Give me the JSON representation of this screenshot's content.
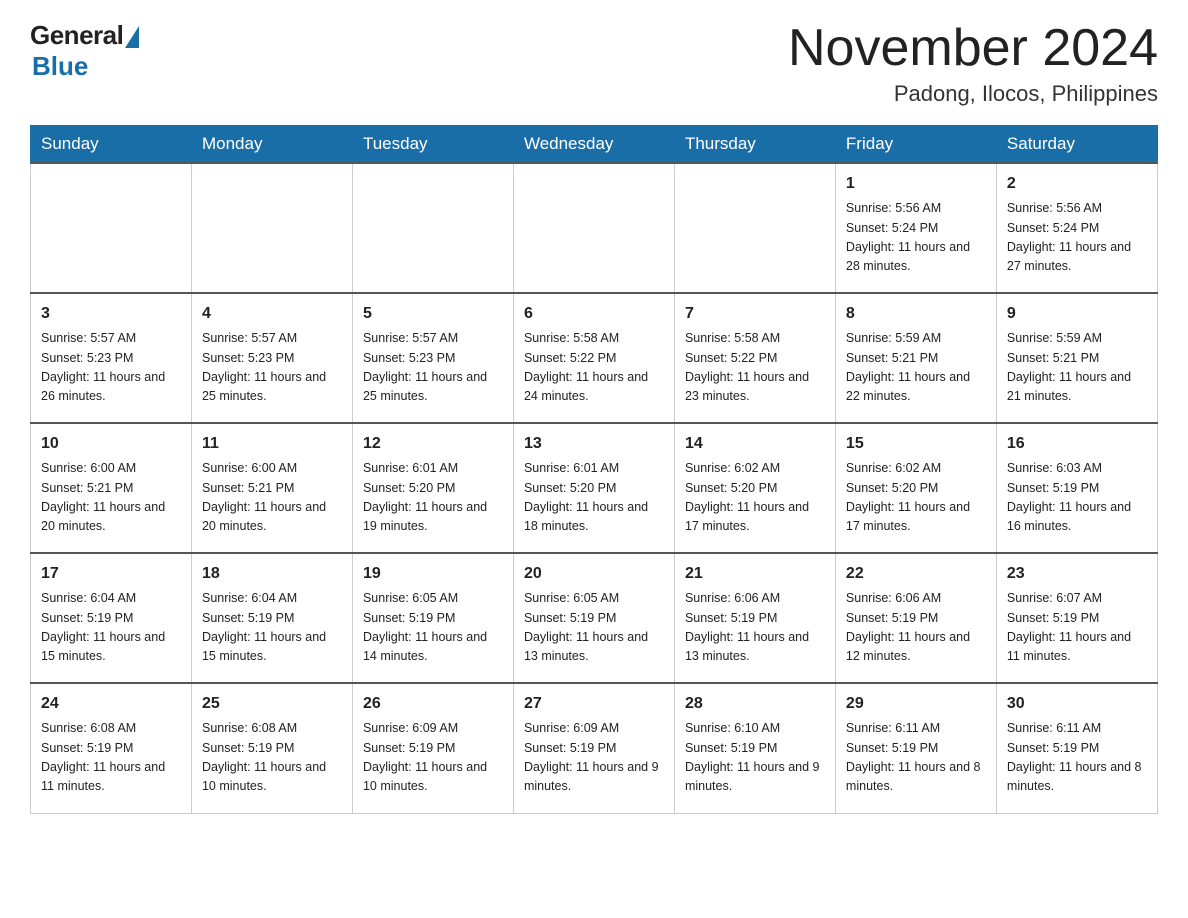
{
  "header": {
    "logo_general": "General",
    "logo_blue": "Blue",
    "month_title": "November 2024",
    "subtitle": "Padong, Ilocos, Philippines"
  },
  "calendar": {
    "days_of_week": [
      "Sunday",
      "Monday",
      "Tuesday",
      "Wednesday",
      "Thursday",
      "Friday",
      "Saturday"
    ],
    "weeks": [
      [
        {
          "day": "",
          "info": ""
        },
        {
          "day": "",
          "info": ""
        },
        {
          "day": "",
          "info": ""
        },
        {
          "day": "",
          "info": ""
        },
        {
          "day": "",
          "info": ""
        },
        {
          "day": "1",
          "info": "Sunrise: 5:56 AM\nSunset: 5:24 PM\nDaylight: 11 hours and 28 minutes."
        },
        {
          "day": "2",
          "info": "Sunrise: 5:56 AM\nSunset: 5:24 PM\nDaylight: 11 hours and 27 minutes."
        }
      ],
      [
        {
          "day": "3",
          "info": "Sunrise: 5:57 AM\nSunset: 5:23 PM\nDaylight: 11 hours and 26 minutes."
        },
        {
          "day": "4",
          "info": "Sunrise: 5:57 AM\nSunset: 5:23 PM\nDaylight: 11 hours and 25 minutes."
        },
        {
          "day": "5",
          "info": "Sunrise: 5:57 AM\nSunset: 5:23 PM\nDaylight: 11 hours and 25 minutes."
        },
        {
          "day": "6",
          "info": "Sunrise: 5:58 AM\nSunset: 5:22 PM\nDaylight: 11 hours and 24 minutes."
        },
        {
          "day": "7",
          "info": "Sunrise: 5:58 AM\nSunset: 5:22 PM\nDaylight: 11 hours and 23 minutes."
        },
        {
          "day": "8",
          "info": "Sunrise: 5:59 AM\nSunset: 5:21 PM\nDaylight: 11 hours and 22 minutes."
        },
        {
          "day": "9",
          "info": "Sunrise: 5:59 AM\nSunset: 5:21 PM\nDaylight: 11 hours and 21 minutes."
        }
      ],
      [
        {
          "day": "10",
          "info": "Sunrise: 6:00 AM\nSunset: 5:21 PM\nDaylight: 11 hours and 20 minutes."
        },
        {
          "day": "11",
          "info": "Sunrise: 6:00 AM\nSunset: 5:21 PM\nDaylight: 11 hours and 20 minutes."
        },
        {
          "day": "12",
          "info": "Sunrise: 6:01 AM\nSunset: 5:20 PM\nDaylight: 11 hours and 19 minutes."
        },
        {
          "day": "13",
          "info": "Sunrise: 6:01 AM\nSunset: 5:20 PM\nDaylight: 11 hours and 18 minutes."
        },
        {
          "day": "14",
          "info": "Sunrise: 6:02 AM\nSunset: 5:20 PM\nDaylight: 11 hours and 17 minutes."
        },
        {
          "day": "15",
          "info": "Sunrise: 6:02 AM\nSunset: 5:20 PM\nDaylight: 11 hours and 17 minutes."
        },
        {
          "day": "16",
          "info": "Sunrise: 6:03 AM\nSunset: 5:19 PM\nDaylight: 11 hours and 16 minutes."
        }
      ],
      [
        {
          "day": "17",
          "info": "Sunrise: 6:04 AM\nSunset: 5:19 PM\nDaylight: 11 hours and 15 minutes."
        },
        {
          "day": "18",
          "info": "Sunrise: 6:04 AM\nSunset: 5:19 PM\nDaylight: 11 hours and 15 minutes."
        },
        {
          "day": "19",
          "info": "Sunrise: 6:05 AM\nSunset: 5:19 PM\nDaylight: 11 hours and 14 minutes."
        },
        {
          "day": "20",
          "info": "Sunrise: 6:05 AM\nSunset: 5:19 PM\nDaylight: 11 hours and 13 minutes."
        },
        {
          "day": "21",
          "info": "Sunrise: 6:06 AM\nSunset: 5:19 PM\nDaylight: 11 hours and 13 minutes."
        },
        {
          "day": "22",
          "info": "Sunrise: 6:06 AM\nSunset: 5:19 PM\nDaylight: 11 hours and 12 minutes."
        },
        {
          "day": "23",
          "info": "Sunrise: 6:07 AM\nSunset: 5:19 PM\nDaylight: 11 hours and 11 minutes."
        }
      ],
      [
        {
          "day": "24",
          "info": "Sunrise: 6:08 AM\nSunset: 5:19 PM\nDaylight: 11 hours and 11 minutes."
        },
        {
          "day": "25",
          "info": "Sunrise: 6:08 AM\nSunset: 5:19 PM\nDaylight: 11 hours and 10 minutes."
        },
        {
          "day": "26",
          "info": "Sunrise: 6:09 AM\nSunset: 5:19 PM\nDaylight: 11 hours and 10 minutes."
        },
        {
          "day": "27",
          "info": "Sunrise: 6:09 AM\nSunset: 5:19 PM\nDaylight: 11 hours and 9 minutes."
        },
        {
          "day": "28",
          "info": "Sunrise: 6:10 AM\nSunset: 5:19 PM\nDaylight: 11 hours and 9 minutes."
        },
        {
          "day": "29",
          "info": "Sunrise: 6:11 AM\nSunset: 5:19 PM\nDaylight: 11 hours and 8 minutes."
        },
        {
          "day": "30",
          "info": "Sunrise: 6:11 AM\nSunset: 5:19 PM\nDaylight: 11 hours and 8 minutes."
        }
      ]
    ]
  }
}
